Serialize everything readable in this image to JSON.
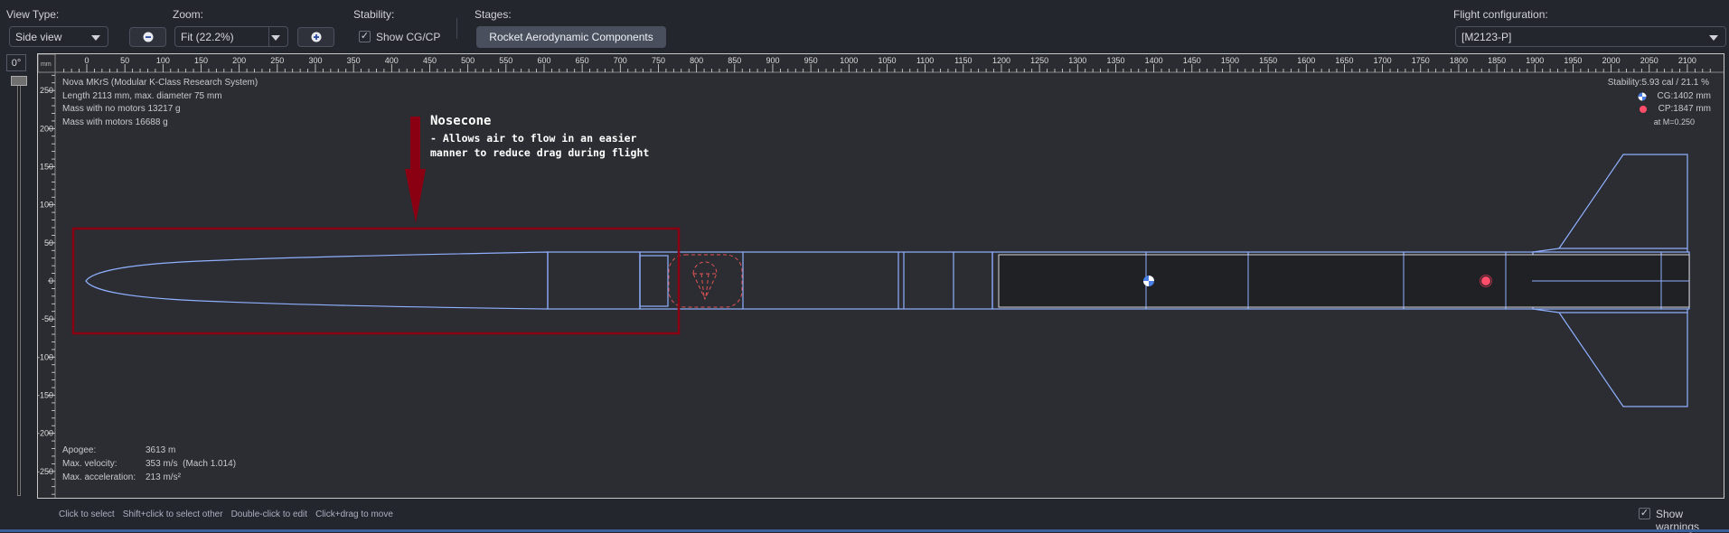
{
  "toolbar": {
    "view_type_label": "View Type:",
    "view_type_value": "Side view",
    "zoom_label": "Zoom:",
    "zoom_value": "Fit (22.2%)",
    "zoom_out_icon": "zoom-out-icon",
    "zoom_in_icon": "zoom-in-icon",
    "stability_label": "Stability:",
    "show_cgcp_label": "Show CG/CP",
    "show_cgcp_checked": true,
    "stages_label": "Stages:",
    "stage_button": "Rocket Aerodynamic Components",
    "flight_config_label": "Flight configuration:",
    "flight_config_value": "[M2123-P]"
  },
  "rotation": {
    "angle": "0°"
  },
  "ruler": {
    "unit": "mm",
    "horizontal": [
      "0",
      "50",
      "100",
      "150",
      "200",
      "250",
      "300",
      "350",
      "400",
      "450",
      "500",
      "550",
      "600",
      "650",
      "700",
      "750",
      "800",
      "850",
      "900",
      "950",
      "1000",
      "1050",
      "1100",
      "1150",
      "1200",
      "1250",
      "1300",
      "1350",
      "1400",
      "1450",
      "1500",
      "1550",
      "1600",
      "1650",
      "1700",
      "1750",
      "1800",
      "1850",
      "1900",
      "1950",
      "2000",
      "2050",
      "2100"
    ],
    "vertical": [
      "250",
      "200",
      "150",
      "100",
      "50",
      "0",
      "-50",
      "-100",
      "-150",
      "-200",
      "-250"
    ]
  },
  "rocket_info": {
    "name": "Nova MKrS (Modular K-Class Research System)",
    "length": "Length 2113 mm, max. diameter 75 mm",
    "mass_no_motors": "Mass with no motors 13217 g",
    "mass_with_motors": "Mass with motors 16688 g"
  },
  "stability_info": {
    "stability": "Stability:5.93 cal / 21.1 %",
    "cg": "CG:1402 mm",
    "cp": "CP:1847 mm",
    "mach": "at M=0.250"
  },
  "flight_info": {
    "apogee_label": "Apogee:",
    "apogee_value": "3613 m",
    "velocity_label": "Max. velocity:",
    "velocity_value": "353 m/s  (Mach 1.014)",
    "accel_label": "Max. acceleration:",
    "accel_value": "213 m/s²"
  },
  "annotation": {
    "title": "Nosecone",
    "line1": "- Allows air to flow in an easier",
    "line2": "manner to reduce drag during flight",
    "color": "#8a0012"
  },
  "status_bar": {
    "hints": [
      "Click to select",
      "Shift+click to select other",
      "Double-click to edit",
      "Click+drag to move"
    ],
    "show_warnings_label": "Show warnings",
    "show_warnings_checked": true
  },
  "colors": {
    "component": "#8fb0ff",
    "cg": "#4a7fe6",
    "cp": "#ff4d6a",
    "recovery": "#e05555"
  }
}
